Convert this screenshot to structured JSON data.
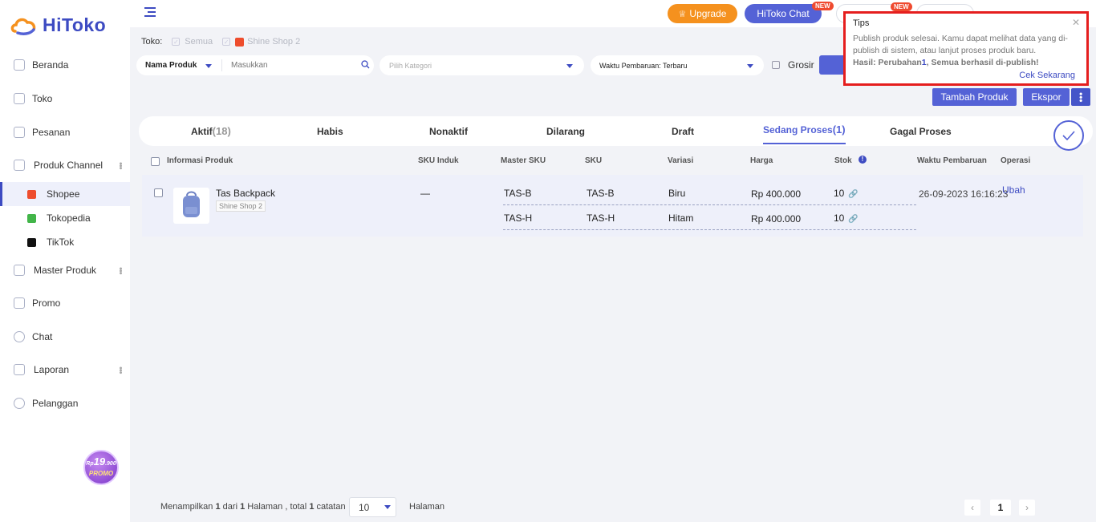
{
  "brand": {
    "name": "HiToko",
    "primary": "#3d4bc2",
    "accent": "#5462d6",
    "upgrade": "#f5911e",
    "highlight": "#e51e1e"
  },
  "sidebar": {
    "items": [
      {
        "label": "Beranda",
        "icon": "monitor-icon"
      },
      {
        "label": "Toko",
        "icon": "store-icon"
      },
      {
        "label": "Pesanan",
        "icon": "calendar-icon"
      },
      {
        "label": "Produk Channel",
        "icon": "grid-icon"
      },
      {
        "label": "Master Produk",
        "icon": "box-icon"
      },
      {
        "label": "Promo",
        "icon": "play-icon"
      },
      {
        "label": "Chat",
        "icon": "chat-icon"
      },
      {
        "label": "Laporan",
        "icon": "report-icon"
      },
      {
        "label": "Pelanggan",
        "icon": "users-icon"
      }
    ],
    "channels": [
      {
        "label": "Shopee",
        "color": "#ee4d2d"
      },
      {
        "label": "Tokopedia",
        "color": "#42b549"
      },
      {
        "label": "TikTok",
        "color": "#111111"
      }
    ],
    "promo": {
      "price": "19",
      "prefix": "Rp",
      "suffix": ".900",
      "label": "PROMO"
    }
  },
  "topbar": {
    "upgrade": "Upgrade",
    "chat": "HiToko Chat",
    "new_badge": "NEW"
  },
  "filters": {
    "toko_label": "Toko:",
    "toko_all": "Semua",
    "toko_shop": "Shine Shop 2",
    "search_type": "Nama Produk",
    "search_placeholder": "Masukkan",
    "category_placeholder": "Pilih Kategori",
    "sort": "Waktu Pembaruan: Terbaru",
    "grosir": "Grosir"
  },
  "actions": {
    "add": "Tambah Produk",
    "export": "Ekspor"
  },
  "tabs": [
    {
      "label": "Aktif",
      "count": "(18)"
    },
    {
      "label": "Habis",
      "count": ""
    },
    {
      "label": "Nonaktif",
      "count": ""
    },
    {
      "label": "Dilarang",
      "count": ""
    },
    {
      "label": "Draft",
      "count": ""
    },
    {
      "label": "Sedang Proses",
      "count": "(1)"
    },
    {
      "label": "Gagal Proses",
      "count": ""
    }
  ],
  "table": {
    "headers": [
      "Informasi Produk",
      "SKU Induk",
      "Master SKU",
      "SKU",
      "Variasi",
      "Harga",
      "Stok",
      "Waktu Pembaruan",
      "Operasi"
    ],
    "product": {
      "name": "Tas Backpack",
      "shop": "Shine Shop 2",
      "sku_induk": "—",
      "updated": "26-09-2023 16:16:23",
      "operation": "Ubah",
      "variants": [
        {
          "master_sku": "TAS-B",
          "sku": "TAS-B",
          "variasi": "Biru",
          "harga": "Rp 400.000",
          "stok": "10"
        },
        {
          "master_sku": "TAS-H",
          "sku": "TAS-H",
          "variasi": "Hitam",
          "harga": "Rp 400.000",
          "stok": "10"
        }
      ]
    }
  },
  "pager": {
    "p1": "Menampilkan",
    "cur": "1",
    "p2": "dari",
    "pages": "1",
    "p3": "Halaman , total",
    "total": "1",
    "p4": "catatan",
    "size": "10",
    "unit": "Halaman",
    "page": "1"
  },
  "tips": {
    "title": "Tips",
    "body": "Publish produk selesai. Kamu dapat melihat data yang di-publish di sistem, atau lanjut proses produk baru.",
    "result_prefix": "Hasil: Perubahan",
    "result_count": "1",
    "result_suffix": ", Semua berhasil di-publish!",
    "link": "Cek Sekarang"
  }
}
